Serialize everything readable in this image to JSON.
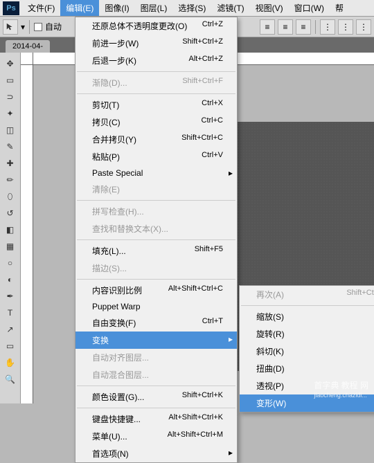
{
  "menubar": {
    "items": [
      "文件(F)",
      "编辑(E)",
      "图像(I)",
      "图层(L)",
      "选择(S)",
      "滤镜(T)",
      "视图(V)",
      "窗口(W)",
      "帮"
    ]
  },
  "toolbar": {
    "auto_label": "自动"
  },
  "tab": {
    "label": "2014-04-"
  },
  "edit_menu": [
    {
      "label": "还原总体不透明度更改(O)",
      "shortcut": "Ctrl+Z"
    },
    {
      "label": "前进一步(W)",
      "shortcut": "Shift+Ctrl+Z"
    },
    {
      "label": "后退一步(K)",
      "shortcut": "Alt+Ctrl+Z"
    },
    {
      "sep": true
    },
    {
      "label": "渐隐(D)...",
      "shortcut": "Shift+Ctrl+F",
      "disabled": true
    },
    {
      "sep": true
    },
    {
      "label": "剪切(T)",
      "shortcut": "Ctrl+X"
    },
    {
      "label": "拷贝(C)",
      "shortcut": "Ctrl+C"
    },
    {
      "label": "合并拷贝(Y)",
      "shortcut": "Shift+Ctrl+C"
    },
    {
      "label": "粘贴(P)",
      "shortcut": "Ctrl+V"
    },
    {
      "label": "Paste Special",
      "arrow": true
    },
    {
      "label": "清除(E)",
      "disabled": true
    },
    {
      "sep": true
    },
    {
      "label": "拼写检查(H)...",
      "disabled": true
    },
    {
      "label": "查找和替换文本(X)...",
      "disabled": true
    },
    {
      "sep": true
    },
    {
      "label": "填充(L)...",
      "shortcut": "Shift+F5"
    },
    {
      "label": "描边(S)...",
      "disabled": true
    },
    {
      "sep": true
    },
    {
      "label": "内容识别比例",
      "shortcut": "Alt+Shift+Ctrl+C"
    },
    {
      "label": "Puppet Warp"
    },
    {
      "label": "自由变换(F)",
      "shortcut": "Ctrl+T"
    },
    {
      "label": "变换",
      "arrow": true,
      "highlight": true
    },
    {
      "label": "自动对齐图层...",
      "disabled": true
    },
    {
      "label": "自动混合图层...",
      "disabled": true
    },
    {
      "sep": true
    },
    {
      "label": "颜色设置(G)...",
      "shortcut": "Shift+Ctrl+K"
    },
    {
      "sep": true
    },
    {
      "label": "键盘快捷键...",
      "shortcut": "Alt+Shift+Ctrl+K"
    },
    {
      "label": "菜单(U)...",
      "shortcut": "Alt+Shift+Ctrl+M"
    },
    {
      "label": "首选项(N)",
      "arrow": true
    }
  ],
  "transform_submenu": [
    {
      "label": "再次(A)",
      "shortcut": "Shift+Ctrl+T",
      "disabled": true
    },
    {
      "sep": true
    },
    {
      "label": "缩放(S)"
    },
    {
      "label": "旋转(R)"
    },
    {
      "label": "斜切(K)"
    },
    {
      "label": "扭曲(D)"
    },
    {
      "label": "透视(P)"
    },
    {
      "label": "变形(W)",
      "highlight": true
    }
  ],
  "watermark": "首字典 教程 网",
  "watermark_sub": "jiaocheng.chazidi..."
}
